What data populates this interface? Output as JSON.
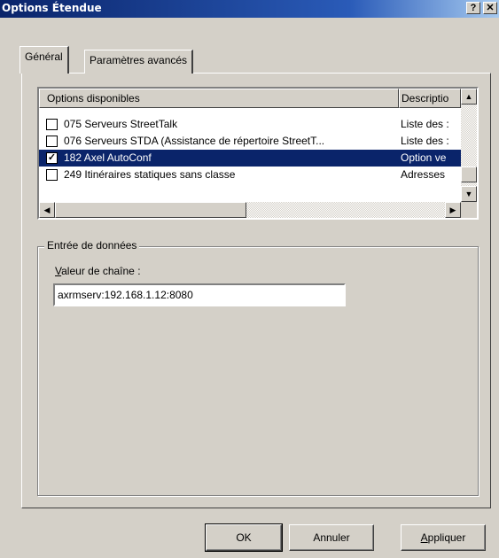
{
  "window": {
    "title": "Options Étendue",
    "help_label": "?",
    "close_label": "✕"
  },
  "tabs": [
    {
      "label": "Général",
      "active": true
    },
    {
      "label": "Paramètres avancés",
      "active": false
    }
  ],
  "options_list": {
    "columns": [
      "Options disponibles",
      "Descriptio"
    ],
    "rows": [
      {
        "checked": false,
        "mark": "",
        "name": "075 Serveurs StreetTalk",
        "desc": "Liste des :",
        "selected": false
      },
      {
        "checked": false,
        "mark": "",
        "name": "076 Serveurs STDA (Assistance de répertoire StreetT...",
        "desc": "Liste des :",
        "selected": false
      },
      {
        "checked": true,
        "mark": "✓",
        "name": "182 Axel AutoConf",
        "desc": "Option ve",
        "selected": true
      },
      {
        "checked": false,
        "mark": "",
        "name": "249 Itinéraires statiques sans classe",
        "desc": "Adresses",
        "selected": false
      }
    ],
    "scroll_up": "▲",
    "scroll_down": "▼",
    "scroll_left": "◀",
    "scroll_right": "▶"
  },
  "data_entry": {
    "group_label": "Entrée de données",
    "field_label_accel": "V",
    "field_label_rest": "aleur de chaîne :",
    "value": "axrmserv:192.168.1.12:8080"
  },
  "buttons": {
    "ok": "OK",
    "cancel": "Annuler",
    "apply_accel": "A",
    "apply_rest": "ppliquer"
  }
}
